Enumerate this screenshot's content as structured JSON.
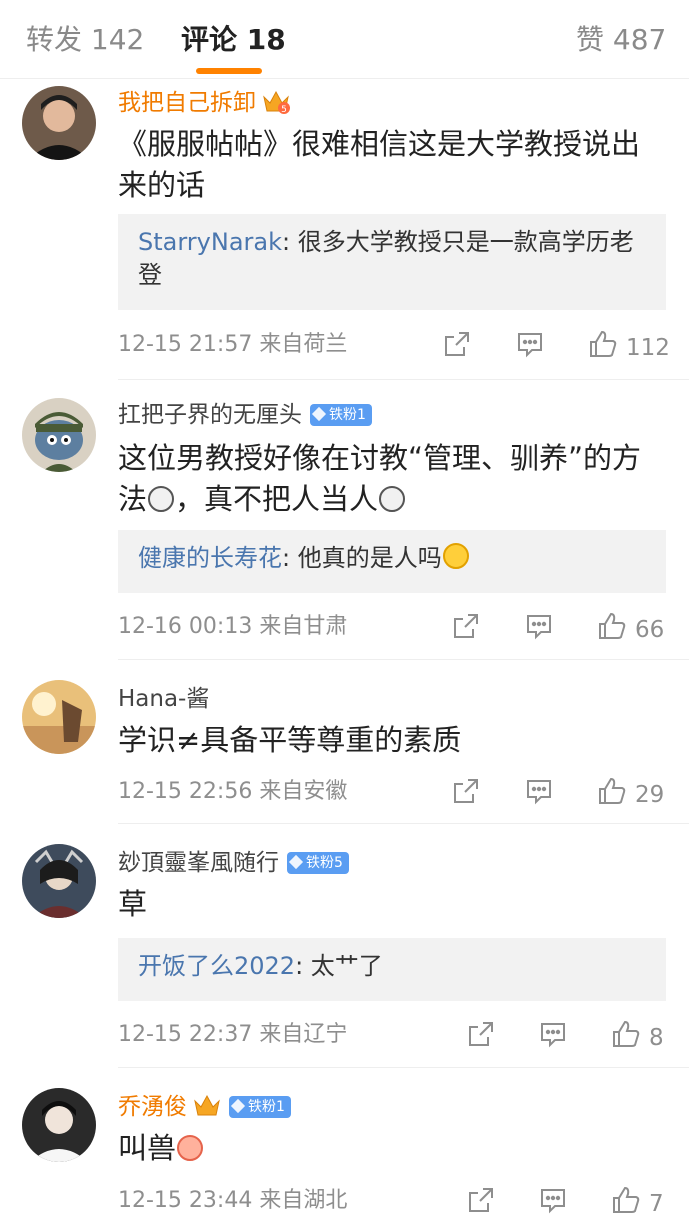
{
  "tabs": {
    "repost": "转发 142",
    "comments": "评论 18",
    "likes": "赞 487"
  },
  "accent_color": "#ff8200",
  "comments": [
    {
      "name": "我把自己拆卸",
      "text": "《服服帖帖》很难相信这是大学教授说出来的话",
      "reply_name": "StarryNarak",
      "reply_text": ": 很多大学教授只是一款高学历老登",
      "time": "12-15 21:57 来自荷兰",
      "likes": "112",
      "crown_level": "5"
    },
    {
      "name": "扛把子界的无厘头",
      "badge": "铁粉1",
      "text_a": "这位男教授好像在讨教“管理、驯养”的方法",
      "text_b": "，真不把人当人",
      "reply_name": "健康的长寿花",
      "reply_text": ": 他真的是人吗",
      "time": "12-16 00:13 来自甘肃",
      "likes": "66"
    },
    {
      "name": "Hana-酱",
      "text": "学识≠具备平等尊重的素质",
      "time": "12-15 22:56 来自安徽",
      "likes": "29"
    },
    {
      "name": "玅頂靈峯風随行",
      "badge": "铁粉5",
      "text": "草",
      "reply_name": "开饭了么2022",
      "reply_text": ": 太艹了",
      "time": "12-15 22:37 来自辽宁",
      "likes": "8"
    },
    {
      "name": "乔湧俊",
      "badge": "铁粉1",
      "text": "叫兽",
      "time": "12-15 23:44 来自湖北",
      "likes": "7"
    }
  ],
  "icons": [
    "crown-icon",
    "diamond-icon",
    "share-icon",
    "comment-icon",
    "like-icon"
  ]
}
